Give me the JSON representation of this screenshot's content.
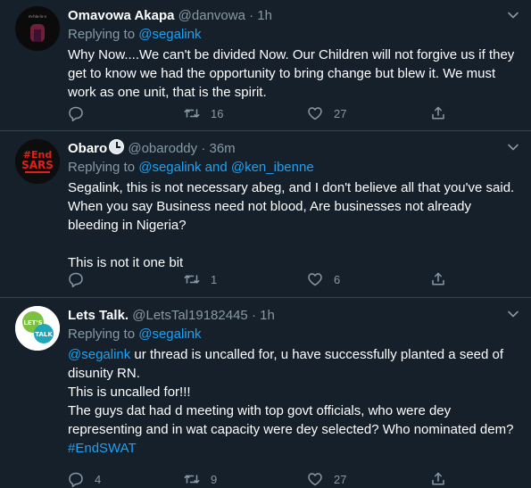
{
  "tweets": [
    {
      "name": "Omavowa Akapa",
      "verified_emoji": "",
      "handle": "@danvowa",
      "time": "1h",
      "replying_prefix": "Replying to",
      "replying_to": "@segalink",
      "replying_and": "",
      "replying_to_2": "",
      "lines": [
        "Why Now....We can't be divided Now. Our Children will not forgive us if they get to know we had the opportunity to bring change but blew it. We must work as one unit, that is the spirit."
      ],
      "reply_count": "",
      "retweet_count": "16",
      "like_count": "27"
    },
    {
      "name": "Obaro",
      "handle": "@obaroddy",
      "time": "36m",
      "replying_prefix": "Replying to",
      "replying_to": "@segalink",
      "replying_and": "and",
      "replying_to_2": "@ken_ibenne",
      "avatar_text_1": "#End",
      "avatar_text_2": "SARS",
      "lines": [
        "Segalink, this is not necessary abeg, and I don't believe all that you've said. When you say Business need not blood, Are businesses not already bleeding in Nigeria?",
        "",
        "This is not it one bit"
      ],
      "reply_count": "",
      "retweet_count": "1",
      "like_count": "6"
    },
    {
      "name": "Lets Talk.",
      "handle": "@LetsTal19182445",
      "time": "1h",
      "replying_prefix": "Replying to",
      "replying_to": "@segalink",
      "avatar_text_1": "LET'S",
      "avatar_text_2": "TALK",
      "mention": "@segalink",
      "first_line_rest": " ur thread is uncalled for, u have successfully planted a seed of disunity RN.",
      "line_2": "This is uncalled for!!!",
      "line_3": "The guys dat had d meeting with top govt officials, who were dey representing and in wat capacity were dey selected? Who nominated dem?",
      "hashtag": "#EndSWAT",
      "reply_count": "4",
      "retweet_count": "9",
      "like_count": "27"
    }
  ],
  "meta_separator": "·",
  "icons": {
    "more": "chevron-down-icon",
    "reply": "reply-icon",
    "retweet": "retweet-icon",
    "like": "heart-icon",
    "share": "share-icon"
  },
  "colors": {
    "background": "#15202b",
    "text": "#ffffff",
    "muted": "#8899a6",
    "link": "#1da1f2",
    "divider": "#38444d"
  }
}
